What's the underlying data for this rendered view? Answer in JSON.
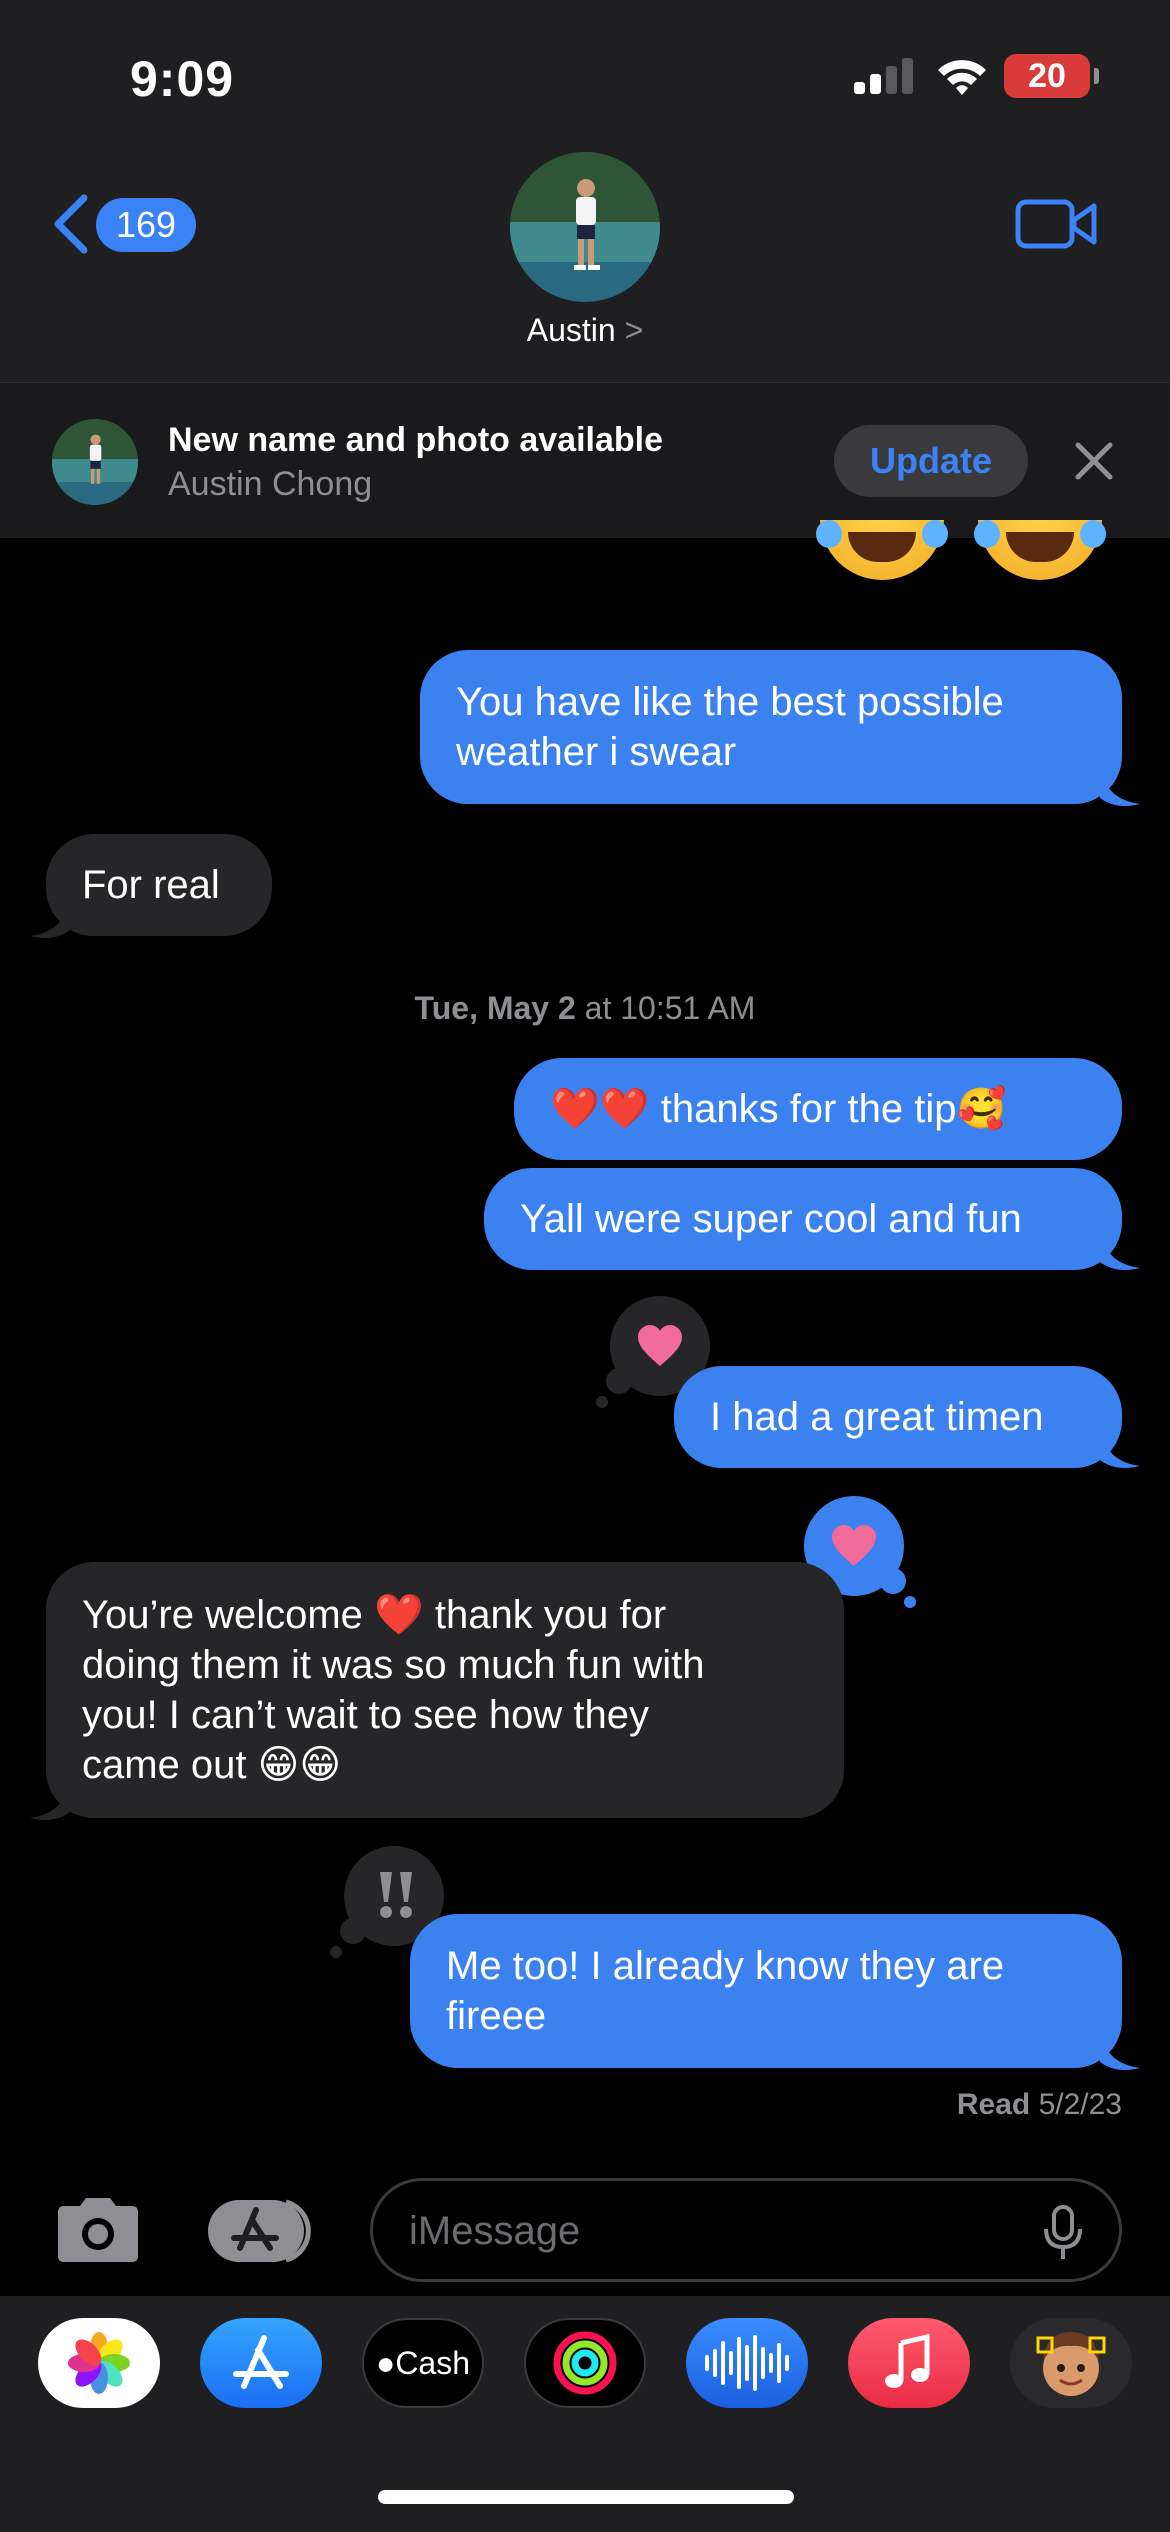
{
  "status_bar": {
    "time": "9:09",
    "battery": "20"
  },
  "nav": {
    "back_count": "169",
    "contact_name": "Austin",
    "chevron": ">"
  },
  "banner": {
    "title": "New name and photo available",
    "subtitle": "Austin  Chong",
    "update_label": "Update"
  },
  "messages": [
    {
      "direction": "out",
      "lines": [
        "You have like the best possible",
        "weather i swear"
      ]
    },
    {
      "direction": "in",
      "lines": [
        "For real"
      ]
    },
    {
      "direction": "out",
      "lines": [
        "❤️❤️ thanks for the tip🥰"
      ]
    },
    {
      "direction": "out",
      "lines": [
        "Yall were super cool and fun"
      ]
    },
    {
      "direction": "out",
      "lines": [
        "I had a great timen"
      ],
      "tapback": "heart"
    },
    {
      "direction": "in",
      "lines": [
        "You’re welcome ❤️ thank you for",
        "doing them it was so much fun with",
        "you! I can’t wait to see how they",
        "came out 😁😁"
      ],
      "tapback": "heart"
    },
    {
      "direction": "out",
      "lines": [
        "Me too! I already know they are",
        "fireee"
      ],
      "tapback": "emphasis"
    }
  ],
  "timestamp": {
    "day": "Tue, May 2",
    "time": "at 10:51 AM"
  },
  "read_receipt": {
    "label": "Read",
    "date": "5/2/23"
  },
  "compose": {
    "placeholder": "iMessage"
  },
  "dock": {
    "apps": [
      "Photos",
      "App Store",
      "Cash",
      "Activity",
      "Audio Message",
      "Music",
      "Memoji"
    ],
    "cash_label": "Cash"
  },
  "colors": {
    "outgoing_bubble": "#3b82f0",
    "incoming_bubble": "#262628",
    "accent": "#3a82f6",
    "heart": "#f06a9a"
  }
}
